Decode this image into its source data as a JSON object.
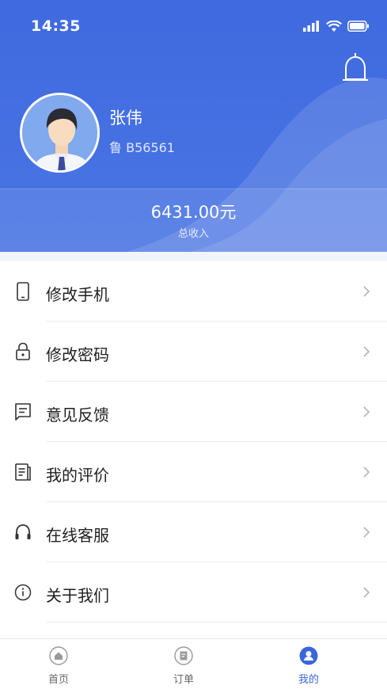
{
  "status_bar": {
    "time": "14:35"
  },
  "profile": {
    "name": "张伟",
    "plate": "鲁 B56561"
  },
  "income": {
    "value": "6431.00元",
    "label": "总收入"
  },
  "menu": [
    {
      "label": "修改手机",
      "icon": "phone-icon"
    },
    {
      "label": "修改密码",
      "icon": "lock-icon"
    },
    {
      "label": "意见反馈",
      "icon": "feedback-icon"
    },
    {
      "label": "我的评价",
      "icon": "review-icon"
    },
    {
      "label": "在线客服",
      "icon": "headset-icon"
    },
    {
      "label": "关于我们",
      "icon": "info-icon"
    }
  ],
  "tabbar": [
    {
      "label": "首页",
      "icon": "home-icon",
      "active": false
    },
    {
      "label": "订单",
      "icon": "order-icon",
      "active": false
    },
    {
      "label": "我的",
      "icon": "profile-icon",
      "active": true
    }
  ],
  "colors": {
    "primary": "#4a75e3",
    "active_tab": "#3a66db"
  }
}
